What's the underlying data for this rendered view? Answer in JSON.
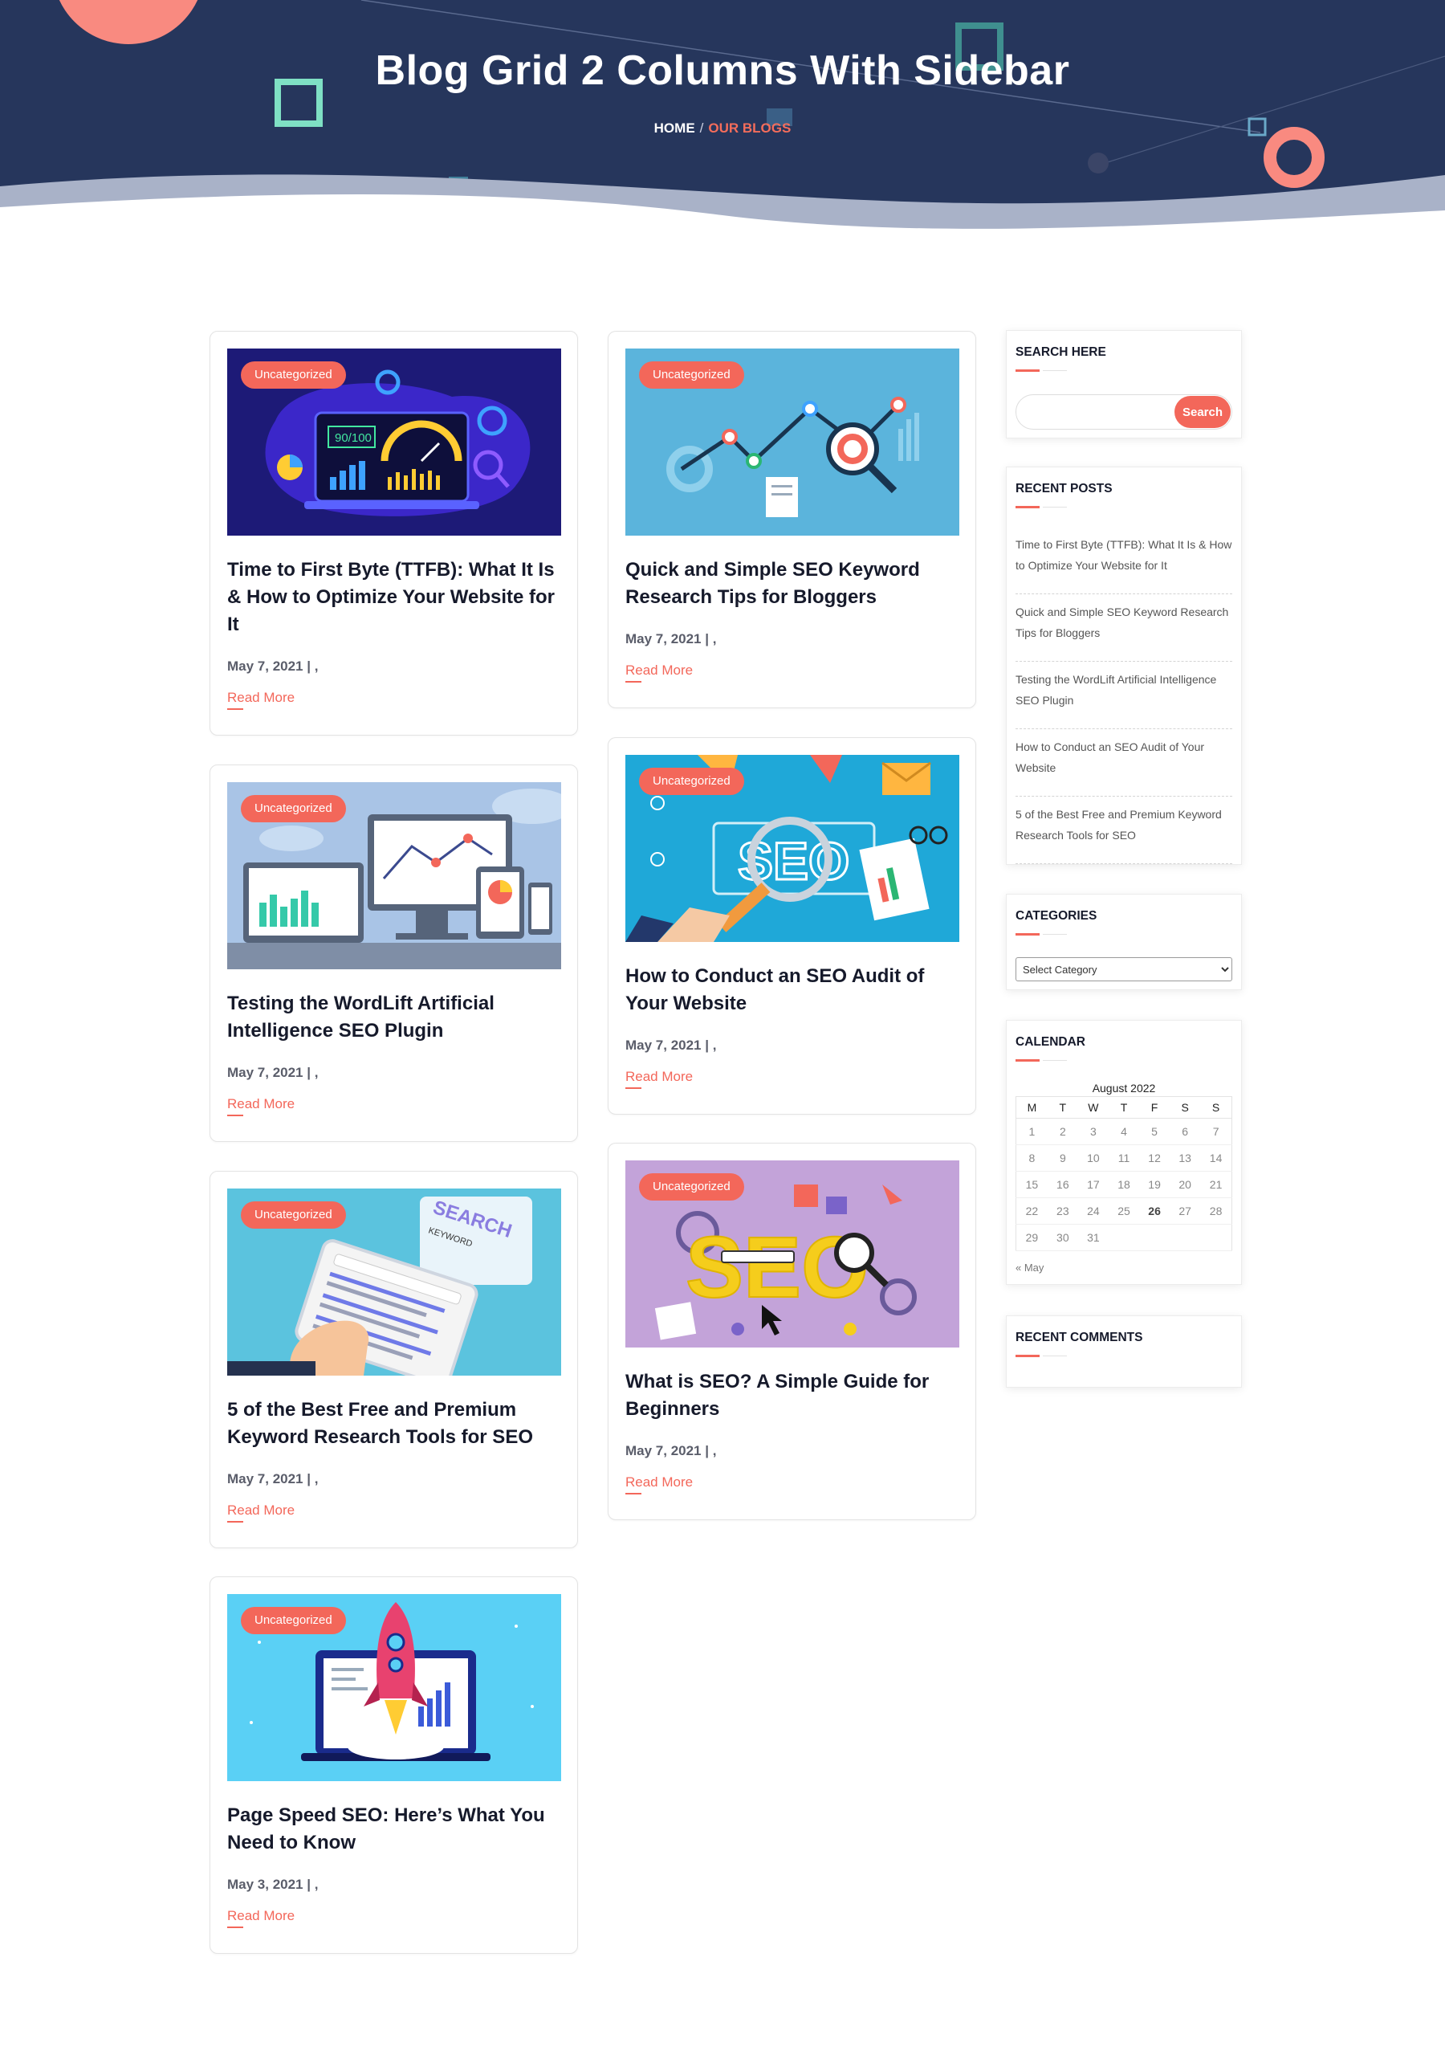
{
  "page": {
    "title": "Blog Grid 2 Columns With Sidebar",
    "breadcrumb": {
      "home": "HOME",
      "separator": "/",
      "current": "OUR BLOGS"
    }
  },
  "colors": {
    "hero_bg": "#26365c",
    "accent": "#f3675a",
    "title": "#161a2b",
    "mint": "#7fe0c4"
  },
  "posts": [
    {
      "badge": "Uncategorized",
      "title": "Time to First Byte (TTFB): What It Is & How to Optimize Your Website for It",
      "meta": "May 7, 2021 | ,",
      "read_more": "Read More",
      "image_icon": "laptop-speed-dashboard-illustration"
    },
    {
      "badge": "Uncategorized",
      "title": "Quick and Simple SEO Keyword Research Tips for Bloggers",
      "meta": "May 7, 2021 | ,",
      "read_more": "Read More",
      "image_icon": "line-graph-magnifier-illustration"
    },
    {
      "badge": "Uncategorized",
      "title": "Testing the WordLift Artificial Intelligence SEO Plugin",
      "meta": "May 7, 2021 | ,",
      "read_more": "Read More",
      "image_icon": "devices-charts-illustration"
    },
    {
      "badge": "Uncategorized",
      "title": "How to Conduct an SEO Audit of Your Website",
      "meta": "May 7, 2021 | ,",
      "read_more": "Read More",
      "image_icon": "seo-magnifier-illustration"
    },
    {
      "badge": "Uncategorized",
      "title": "5 of the Best Free and Premium Keyword Research Tools for SEO",
      "meta": "May 7, 2021 | ,",
      "read_more": "Read More",
      "image_icon": "tablet-search-illustration"
    },
    {
      "badge": "Uncategorized",
      "title": "What is SEO? A Simple Guide for Beginners",
      "meta": "May 7, 2021 | ,",
      "read_more": "Read More",
      "image_icon": "seo-letters-illustration"
    },
    {
      "badge": "Uncategorized",
      "title": "Page Speed SEO: Here’s What You Need to Know",
      "meta": "May 3, 2021 | ,",
      "read_more": "Read More",
      "image_icon": "rocket-laptop-illustration"
    }
  ],
  "sidebar": {
    "search": {
      "title": "SEARCH HERE",
      "placeholder": "",
      "button": "Search"
    },
    "recent_posts": {
      "title": "RECENT POSTS",
      "items": [
        "Time to First Byte (TTFB): What It Is & How to Optimize Your Website for It",
        "Quick and Simple SEO Keyword Research Tips for Bloggers",
        "Testing the WordLift Artificial Intelligence SEO Plugin",
        "How to Conduct an SEO Audit of Your Website",
        "5 of the Best Free and Premium Keyword Research Tools for SEO"
      ]
    },
    "categories": {
      "title": "CATEGORIES",
      "selected": "Select Category"
    },
    "calendar": {
      "title": "CALENDAR",
      "caption": "August 2022",
      "weekdays": [
        "M",
        "T",
        "W",
        "T",
        "F",
        "S",
        "S"
      ],
      "rows": [
        [
          "1",
          "2",
          "3",
          "4",
          "5",
          "6",
          "7"
        ],
        [
          "8",
          "9",
          "10",
          "11",
          "12",
          "13",
          "14"
        ],
        [
          "15",
          "16",
          "17",
          "18",
          "19",
          "20",
          "21"
        ],
        [
          "22",
          "23",
          "24",
          "25",
          "26",
          "27",
          "28"
        ],
        [
          "29",
          "30",
          "31",
          "",
          "",
          "",
          ""
        ]
      ],
      "today": "26",
      "prev": "« May"
    },
    "recent_comments": {
      "title": "RECENT COMMENTS"
    }
  }
}
